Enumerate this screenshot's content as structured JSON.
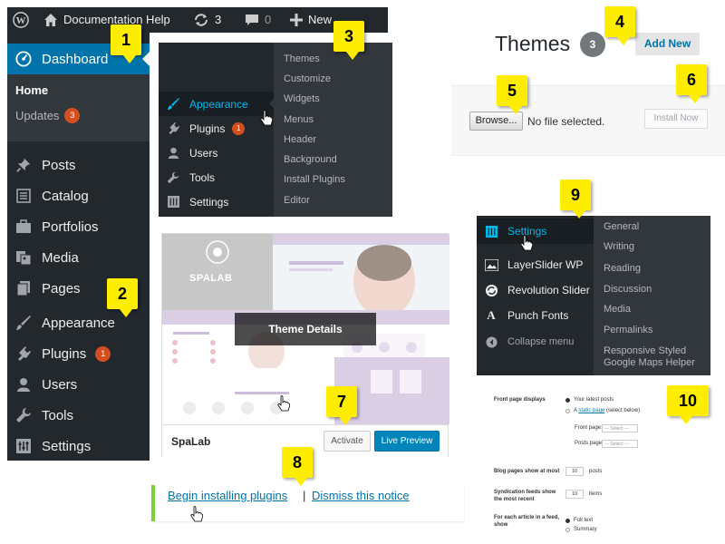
{
  "admin_bar": {
    "site_name": "Documentation Help",
    "updates_count": "3",
    "comments_count": "0",
    "new_label": "New"
  },
  "sidebar": {
    "dashboard": "Dashboard",
    "home": "Home",
    "updates": "Updates",
    "updates_badge": "3",
    "items": [
      {
        "label": "Posts",
        "icon": "pushpin-icon"
      },
      {
        "label": "Catalog",
        "icon": "catalog-icon"
      },
      {
        "label": "Portfolios",
        "icon": "portfolio-icon"
      },
      {
        "label": "Media",
        "icon": "media-icon"
      },
      {
        "label": "Pages",
        "icon": "pages-icon"
      },
      {
        "label": "Appearance",
        "icon": "brush-icon"
      },
      {
        "label": "Plugins",
        "icon": "plug-icon",
        "badge": "1"
      },
      {
        "label": "Users",
        "icon": "user-icon"
      },
      {
        "label": "Tools",
        "icon": "wrench-icon"
      },
      {
        "label": "Settings",
        "icon": "settings-icon"
      }
    ]
  },
  "appearance_menu": {
    "items": [
      {
        "label": "Appearance",
        "icon": "brush-icon"
      },
      {
        "label": "Plugins",
        "icon": "plug-icon",
        "badge": "1"
      },
      {
        "label": "Users",
        "icon": "user-icon"
      },
      {
        "label": "Tools",
        "icon": "wrench-icon"
      },
      {
        "label": "Settings",
        "icon": "settings-icon"
      }
    ],
    "submenu": [
      "Themes",
      "Customize",
      "Widgets",
      "Menus",
      "Header",
      "Background",
      "Install Plugins",
      "Editor"
    ]
  },
  "themes_header": {
    "title": "Themes",
    "count": "3",
    "add_new": "Add New"
  },
  "upload": {
    "browse": "Browse...",
    "no_file": "No file selected.",
    "install_now": "Install Now"
  },
  "theme_card": {
    "name": "SpaLab",
    "logo_text": "SPALAB",
    "details": "Theme Details",
    "activate": "Activate",
    "live_preview": "Live Preview"
  },
  "notice": {
    "begin": "Begin installing plugins",
    "separator": "|",
    "dismiss": "Dismiss this notice"
  },
  "settings_menu": {
    "items": [
      {
        "label": "Settings",
        "icon": "settings-icon"
      },
      {
        "label": "LayerSlider WP",
        "icon": "layers-icon"
      },
      {
        "label": "Revolution Slider",
        "icon": "refresh-icon"
      },
      {
        "label": "Punch Fonts",
        "icon": "font-icon"
      },
      {
        "label": "Collapse menu",
        "icon": "collapse-icon"
      }
    ],
    "submenu": [
      "General",
      "Writing",
      "Reading",
      "Discussion",
      "Media",
      "Permalinks",
      "Responsive Styled Google Maps Helper"
    ]
  },
  "reading": {
    "front_page_displays": "Front page displays",
    "latest_posts": "Your latest posts",
    "a": "A",
    "static_page": "static page",
    "select_below": "(select below)",
    "front_page": "Front page:",
    "posts_page": "Posts page:",
    "select": "— Select —",
    "blog_pages": "Blog pages show at most",
    "blog_pages_value": "10",
    "posts_unit": "posts",
    "syndication": "Syndication feeds show the most recent",
    "syndication_value": "10",
    "items_unit": "items",
    "each_article": "For each article in a feed, show",
    "full_text": "Full text",
    "summary": "Summary"
  },
  "callouts": [
    "1",
    "2",
    "3",
    "4",
    "5",
    "6",
    "7",
    "8",
    "9",
    "10"
  ],
  "colors": {
    "admin_dark": "#23282d",
    "submenu": "#32373c",
    "active_blue": "#0073aa",
    "callout_yellow": "#ffed00",
    "badge_orange": "#d54e21",
    "notice_green": "#7ad03a"
  }
}
